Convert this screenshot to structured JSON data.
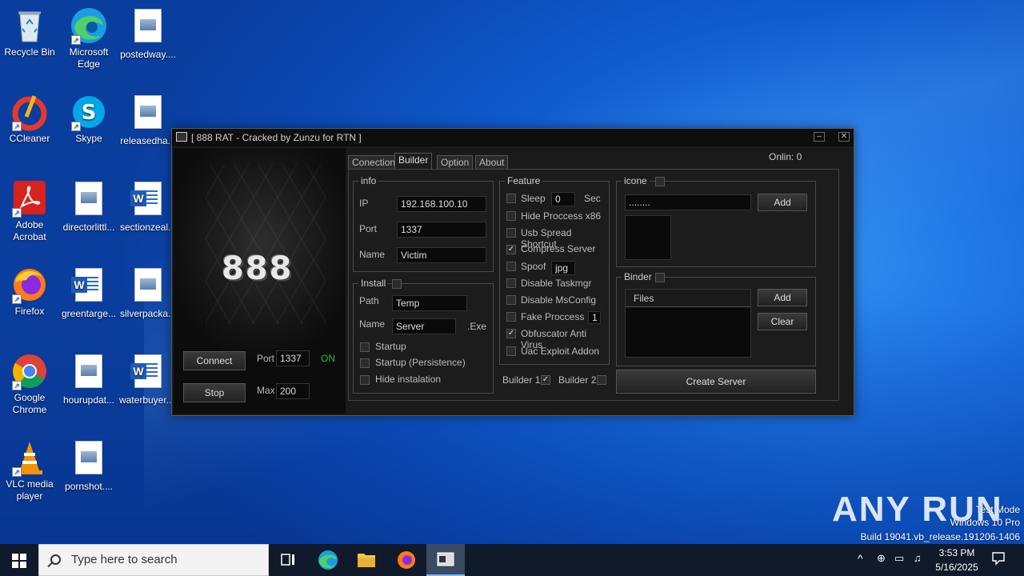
{
  "desktop": {
    "icons": [
      {
        "label": "Recycle Bin"
      },
      {
        "label": "Microsoft Edge"
      },
      {
        "label": "postedway...."
      },
      {
        "label": "CCleaner"
      },
      {
        "label": "Skype"
      },
      {
        "label": "releasedha..."
      },
      {
        "label": "Adobe Acrobat"
      },
      {
        "label": "directorlittl..."
      },
      {
        "label": "sectionzeal..."
      },
      {
        "label": "Firefox"
      },
      {
        "label": "greentarge..."
      },
      {
        "label": "silverpacka..."
      },
      {
        "label": "Google Chrome"
      },
      {
        "label": "hourupdat..."
      },
      {
        "label": "waterbuyer...."
      },
      {
        "label": "VLC media player"
      },
      {
        "label": "pornshot...."
      }
    ]
  },
  "window": {
    "title": "[  888 RAT - Cracked by Zunzu for RTN ]",
    "logo": "888",
    "connect_label": "Connect",
    "stop_label": "Stop",
    "port_label": "Port",
    "port_value": "1337",
    "on_label": "ON",
    "max_label": "Max",
    "max_value": "200",
    "online_label": "Onlin:  0",
    "tabs": [
      {
        "label": "Conection"
      },
      {
        "label": "Builder"
      },
      {
        "label": "Option"
      },
      {
        "label": "About"
      }
    ],
    "info": {
      "title": "info",
      "ip_label": "IP",
      "ip_value": "192.168.100.10",
      "port_label": "Port",
      "port_value": "1337",
      "name_label": "Name",
      "name_value": "Victim"
    },
    "install": {
      "title": "Install",
      "path_label": "Path",
      "path_value": "Temp",
      "name_label": "Name",
      "name_value": "Server",
      "ext_label": ".Exe",
      "startup_label": "Startup",
      "startup_persist_label": "Startup (Persistence)",
      "hide_label": "Hide instalation"
    },
    "feature": {
      "title": "Feature",
      "sleep_label": "Sleep",
      "sleep_value": "0",
      "sec_label": "Sec",
      "hide_process_label": "Hide Proccess x86",
      "usb_label": "Usb Spread Shortcut",
      "compress_label": "Compress Server",
      "spoof_label": "Spoof",
      "spoof_value": "jpg",
      "taskmgr_label": "Disable Taskmgr",
      "msconfig_label": "Disable MsConfig",
      "fake_label": "Fake Proccess",
      "fake_value": "1",
      "obf_label": "Obfuscator Anti Virus",
      "uac_label": "Uac Exploit Addon"
    },
    "icone": {
      "title": "icone",
      "path_value": "........",
      "add_label": "Add"
    },
    "binder": {
      "title": "Binder",
      "files_header": "Files",
      "add_label": "Add",
      "clear_label": "Clear"
    },
    "builder1_label": "Builder 1",
    "builder2_label": "Builder 2",
    "create_label": "Create Server",
    "checkmark": "✓"
  },
  "taskbar": {
    "search_placeholder": "Type here to search",
    "time": "3:53 PM",
    "date": "5/16/2025"
  },
  "watermark": {
    "brand": "ANY RUN",
    "line1": "Test Mode",
    "line2": "Windows 10 Pro",
    "line3": "Build 19041.vb_release.191206-1406"
  }
}
